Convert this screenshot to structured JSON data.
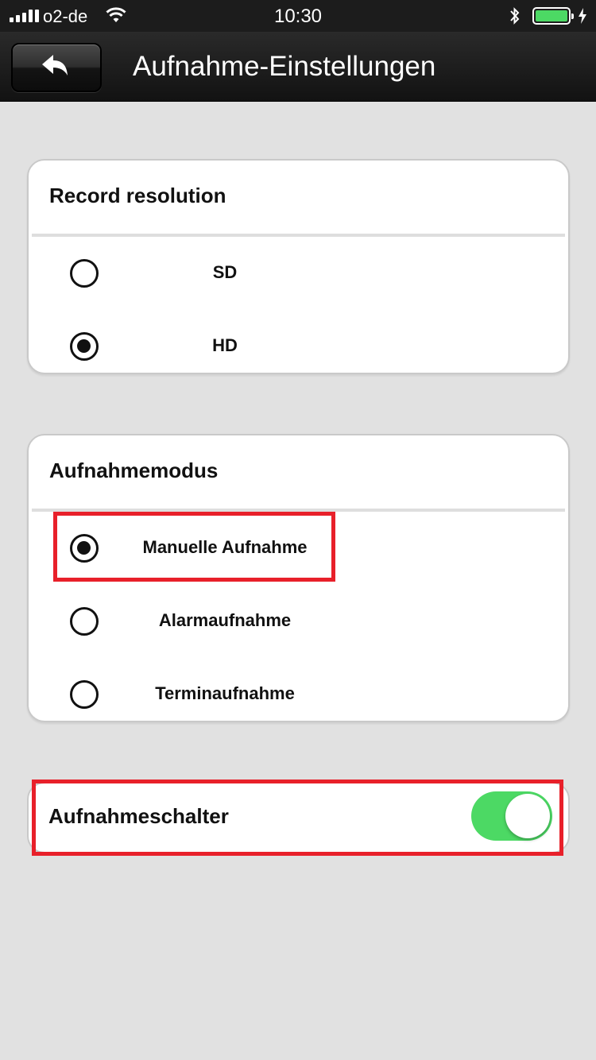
{
  "status_bar": {
    "carrier": "o2-de",
    "time": "10:30",
    "battery_level": 1.0
  },
  "nav": {
    "title": "Aufnahme-Einstellungen",
    "back_icon": "reply-arrow-icon"
  },
  "resolution": {
    "header": "Record resolution",
    "options": [
      {
        "label": "SD",
        "selected": false
      },
      {
        "label": "HD",
        "selected": true
      }
    ]
  },
  "mode": {
    "header": "Aufnahmemodus",
    "options": [
      {
        "label": "Manuelle Aufnahme",
        "selected": true
      },
      {
        "label": "Alarmaufnahme",
        "selected": false
      },
      {
        "label": "Terminaufnahme",
        "selected": false
      }
    ]
  },
  "switch": {
    "label": "Aufnahmeschalter",
    "on": true
  },
  "colors": {
    "switch_on": "#4cd964",
    "highlight": "#e8202a",
    "background": "#e1e1e1"
  }
}
